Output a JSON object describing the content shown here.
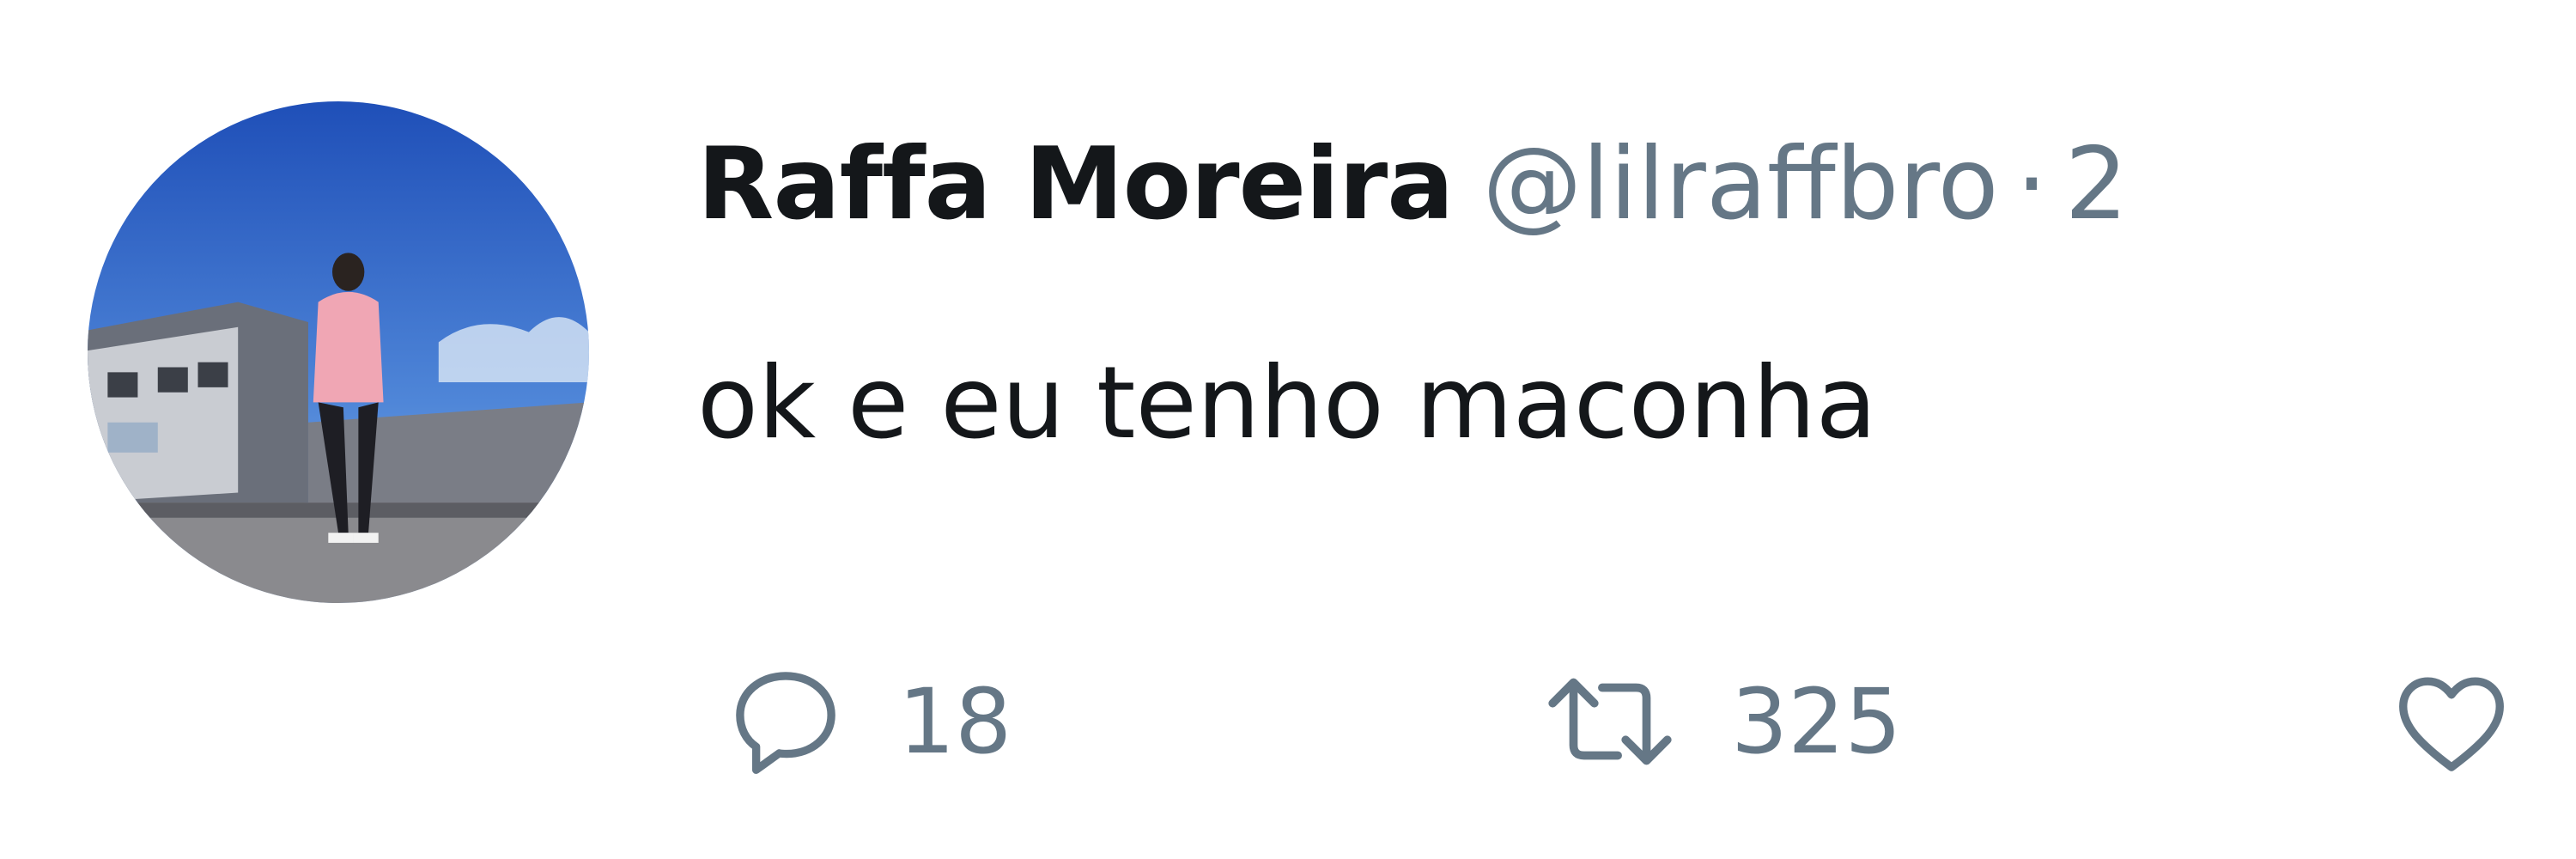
{
  "tweet": {
    "author": {
      "display_name": "Raffa Moreira",
      "handle": "@lilraffbro",
      "avatar_icon": "avatar-photo"
    },
    "separator": "·",
    "timestamp_partial": "2",
    "text": "ok e eu tenho maconha",
    "actions": {
      "reply": {
        "icon": "reply-icon",
        "count": "18"
      },
      "retweet": {
        "icon": "retweet-icon",
        "count": "325"
      },
      "like": {
        "icon": "heart-icon",
        "count": ""
      }
    }
  },
  "colors": {
    "text_primary": "#14171a",
    "text_secondary": "#657786",
    "background": "#ffffff"
  }
}
